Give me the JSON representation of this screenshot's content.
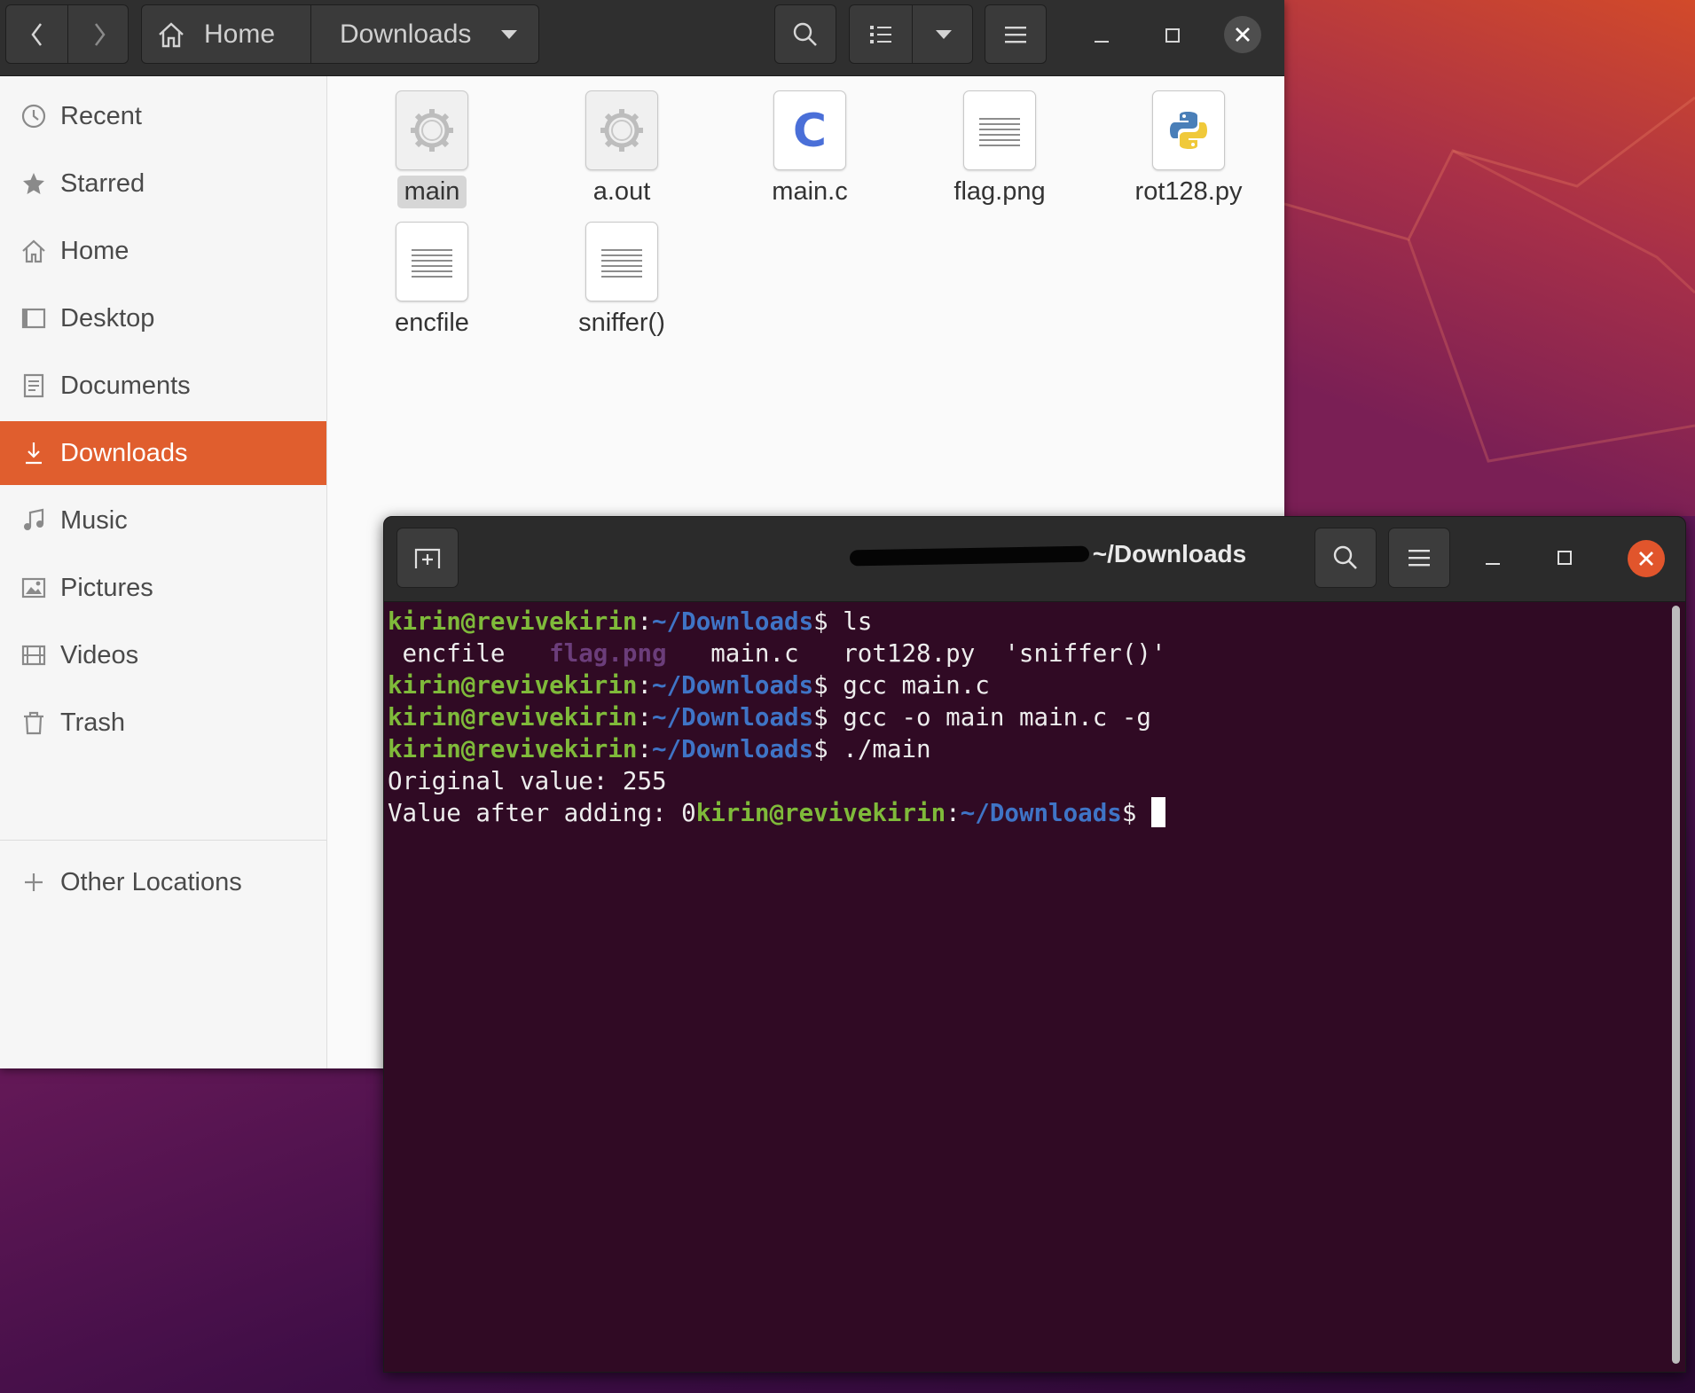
{
  "file_manager": {
    "nav": {
      "back_icon": "chevron-left-icon",
      "forward_icon": "chevron-right-icon"
    },
    "path": {
      "home_label": "Home",
      "current_label": "Downloads"
    },
    "sidebar": {
      "items": [
        {
          "label": "Recent",
          "icon": "clock-icon"
        },
        {
          "label": "Starred",
          "icon": "star-icon"
        },
        {
          "label": "Home",
          "icon": "home-icon"
        },
        {
          "label": "Desktop",
          "icon": "desktop-icon"
        },
        {
          "label": "Documents",
          "icon": "document-icon"
        },
        {
          "label": "Downloads",
          "icon": "download-icon"
        },
        {
          "label": "Music",
          "icon": "music-icon"
        },
        {
          "label": "Pictures",
          "icon": "picture-icon"
        },
        {
          "label": "Videos",
          "icon": "video-icon"
        },
        {
          "label": "Trash",
          "icon": "trash-icon"
        },
        {
          "label": "Other Locations",
          "icon": "plus-icon"
        }
      ]
    },
    "files": [
      {
        "name": "main",
        "icon": "executable-icon",
        "selected": true
      },
      {
        "name": "a.out",
        "icon": "executable-icon"
      },
      {
        "name": "main.c",
        "icon": "c-source-icon"
      },
      {
        "name": "flag.png",
        "icon": "text-file-icon"
      },
      {
        "name": "rot128.py",
        "icon": "python-icon"
      },
      {
        "name": "encfile",
        "icon": "text-file-icon"
      },
      {
        "name": "sniffer()",
        "icon": "text-file-icon"
      }
    ]
  },
  "terminal": {
    "title_suffix": "~/Downloads",
    "prompt_user": "kirin@revivekirin",
    "prompt_path": "~/Downloads",
    "prompt_colon": ":",
    "prompt_dollar": "$",
    "commands": {
      "c1": " ls",
      "c2": " gcc main.c",
      "c3": " gcc -o main main.c -g",
      "c4": " ./main",
      "c5": " "
    },
    "ls_output": {
      "encfile": " encfile   ",
      "flag": "flag.png",
      "rest": "   main.c   rot128.py  'sniffer()'"
    },
    "output": {
      "line1": "Original value: 255",
      "line2": "Value after adding: 0"
    }
  },
  "colors": {
    "accent": "#e05e2e",
    "terminal_bg": "#300a24",
    "prompt_user": "#7fba3a",
    "prompt_path": "#3f74c6"
  }
}
